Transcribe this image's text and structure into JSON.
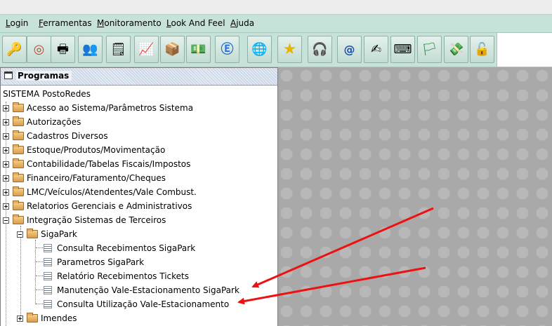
{
  "menubar": {
    "items": [
      {
        "label": "Login",
        "mnemonic": "L",
        "rest": "ogin"
      },
      {
        "label": "Ferramentas",
        "mnemonic": "F",
        "rest": "erramentas"
      },
      {
        "label": "Monitoramento",
        "mnemonic": "M",
        "rest": "onitoramento"
      },
      {
        "label": "Look And Feel",
        "mnemonic": "L",
        "rest": "ook And Feel"
      },
      {
        "label": "Ajuda",
        "mnemonic": "A",
        "rest": "juda"
      }
    ]
  },
  "toolbar": {
    "buttons": [
      {
        "icon": "keys-icon",
        "glyph": "🔑"
      },
      {
        "icon": "lifebuoy-icon",
        "glyph": "◎"
      },
      {
        "icon": "printer-icon",
        "glyph": "🖶"
      },
      {
        "icon": "users-computer-icon",
        "glyph": "👥"
      },
      {
        "icon": "notepad-icon",
        "glyph": "🗒"
      },
      {
        "icon": "chart-check-icon",
        "glyph": "📈"
      },
      {
        "icon": "box-icon",
        "glyph": "📦"
      },
      {
        "icon": "money-icon",
        "glyph": "💵"
      },
      {
        "icon": "nfe-icon",
        "glyph": "Ⓔ"
      },
      {
        "icon": "browser-icon",
        "glyph": "🌐"
      },
      {
        "icon": "star-icon",
        "glyph": "★"
      },
      {
        "icon": "support-headset-icon",
        "glyph": "🎧"
      },
      {
        "icon": "email-at-icon",
        "glyph": "@"
      },
      {
        "icon": "signature-icon",
        "glyph": "✍"
      },
      {
        "icon": "keyboard-icon",
        "glyph": "⌨"
      },
      {
        "icon": "lmc-flag-icon",
        "glyph": "🏳"
      },
      {
        "icon": "cash-icon",
        "glyph": "💸"
      },
      {
        "icon": "padlock-icon",
        "glyph": "🔓"
      }
    ]
  },
  "panel": {
    "title": "Programas",
    "root": "SISTEMA PostoRedes",
    "items": [
      {
        "label": "Acesso ao Sistema/Parâmetros Sistema",
        "type": "folder",
        "expanded": false
      },
      {
        "label": "Autorizações",
        "type": "folder",
        "expanded": false
      },
      {
        "label": "Cadastros Diversos",
        "type": "folder",
        "expanded": false
      },
      {
        "label": "Estoque/Produtos/Movimentação",
        "type": "folder",
        "expanded": false
      },
      {
        "label": "Contabilidade/Tabelas Fiscais/Impostos",
        "type": "folder",
        "expanded": false
      },
      {
        "label": "Financeiro/Faturamento/Cheques",
        "type": "folder",
        "expanded": false
      },
      {
        "label": "LMC/Veículos/Atendentes/Vale Combust.",
        "type": "folder",
        "expanded": false
      },
      {
        "label": "Relatorios Gerenciais e Administrativos",
        "type": "folder",
        "expanded": false
      },
      {
        "label": "Integração Sistemas de Terceiros",
        "type": "folder",
        "expanded": true
      },
      {
        "label": "SigaPark",
        "type": "folder",
        "expanded": true
      },
      {
        "label": "Consulta Recebimentos SigaPark",
        "type": "program"
      },
      {
        "label": "Parametros SigaPark",
        "type": "program"
      },
      {
        "label": "Relatório Recebimentos Tickets",
        "type": "program"
      },
      {
        "label": "Manutenção Vale-Estacionamento SigaPark",
        "type": "program"
      },
      {
        "label": "Consulta Utilização Vale-Estacionamento",
        "type": "program"
      },
      {
        "label": "Imendes",
        "type": "folder",
        "expanded": false
      }
    ]
  },
  "colors": {
    "menubar_bg": "#c7e2d9",
    "desktop_bg": "#a9a9a9",
    "annotation_arrow": "#ee1111"
  }
}
